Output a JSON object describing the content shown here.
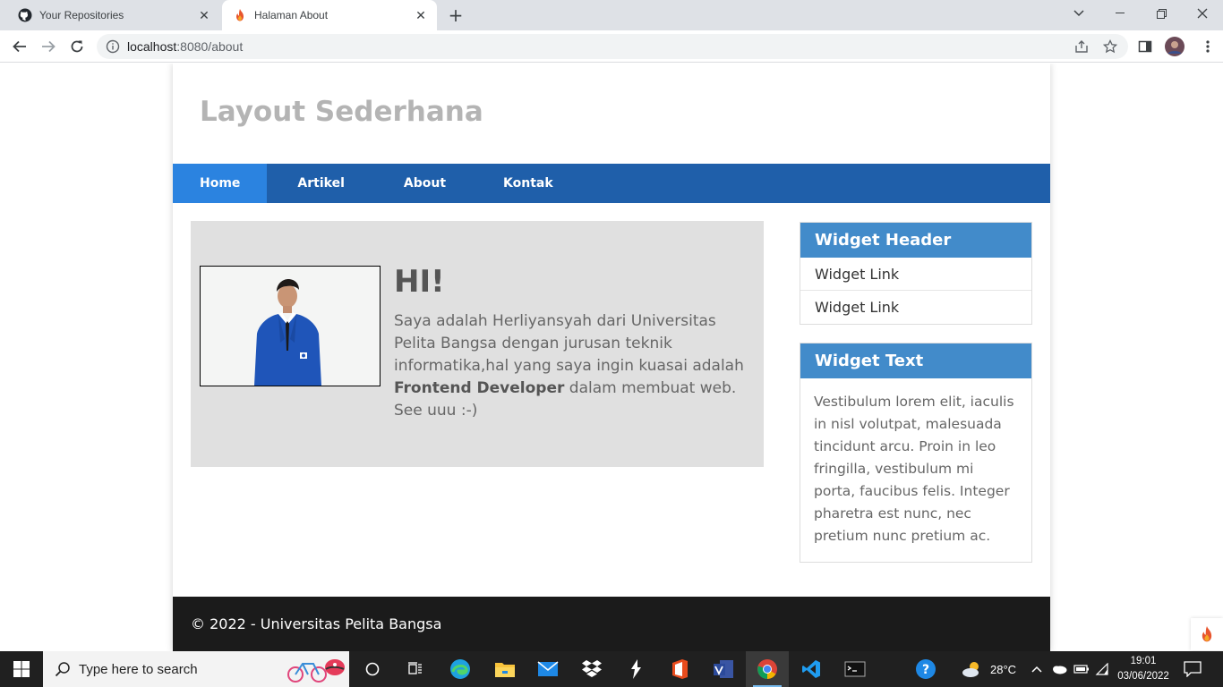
{
  "browser": {
    "tabs": [
      {
        "title": "Your Repositories",
        "icon": "github-icon",
        "active": false
      },
      {
        "title": "Halaman About",
        "icon": "flame-icon",
        "active": true
      }
    ],
    "url_host": "localhost",
    "url_rest": ":8080/about"
  },
  "site": {
    "title": "Layout Sederhana",
    "nav": [
      "Home",
      "Artikel",
      "About",
      "Kontak"
    ],
    "active_nav": "Home",
    "hero": {
      "heading": "HI!",
      "text_1": "Saya adalah Herliyansyah dari Universitas Pelita Bangsa dengan jurusan teknik informatika,hal yang saya ingin kuasai adalah ",
      "text_bold": "Frontend Developer",
      "text_2": " dalam membuat web. See uuu :-)"
    },
    "widget_links": {
      "header": "Widget Header",
      "links": [
        "Widget Link",
        "Widget Link"
      ]
    },
    "widget_text": {
      "header": "Widget Text",
      "body": "Vestibulum lorem elit, iaculis in nisl volutpat, malesuada tincidunt arcu. Proin in leo fringilla, vestibulum mi porta, faucibus felis. Integer pharetra est nunc, nec pretium nunc pretium ac."
    },
    "footer": "© 2022 - Universitas Pelita Bangsa"
  },
  "taskbar": {
    "search_placeholder": "Type here to search",
    "temperature": "28°C",
    "time": "19:01",
    "date": "03/06/2022"
  },
  "colors": {
    "nav_bg": "#1f5faa",
    "nav_active": "#2b83e0",
    "widget_header": "#428bca",
    "footer_bg": "#1b1b1b",
    "hero_bg": "#e0e0e0"
  }
}
